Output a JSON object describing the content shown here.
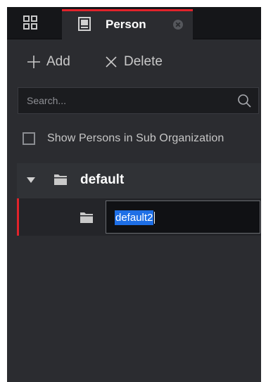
{
  "tabs": [
    {
      "label": "Person",
      "active": true,
      "icon": "person-card-icon"
    }
  ],
  "colors": {
    "accent": "#e2232b",
    "panel": "#2b2c30",
    "tabbar": "#151619",
    "selection": "#1e6fe6"
  },
  "toolbar": {
    "add_label": "Add",
    "delete_label": "Delete"
  },
  "search": {
    "placeholder": "Search...",
    "value": ""
  },
  "sub_org": {
    "label": "Show Persons in Sub Organization",
    "checked": false
  },
  "tree": {
    "root": {
      "label": "default",
      "expanded": true
    },
    "children": [
      {
        "label": "default2",
        "editing": true
      }
    ]
  }
}
